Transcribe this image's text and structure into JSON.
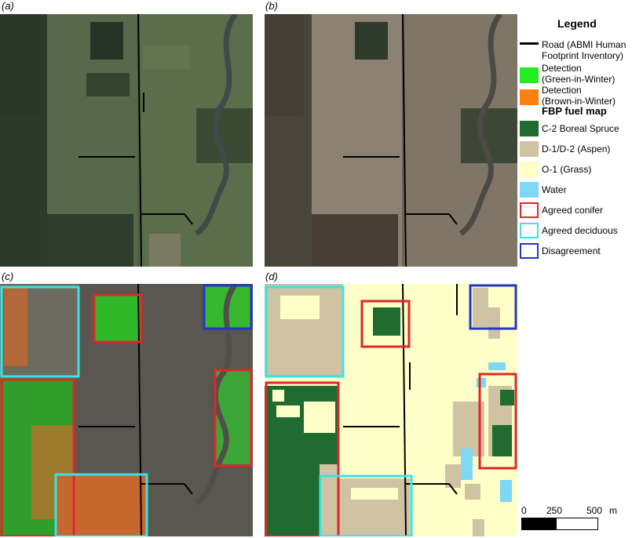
{
  "panels": {
    "a": "(a)",
    "b": "(b)",
    "c": "(c)",
    "d": "(d)"
  },
  "legend": {
    "title": "Legend",
    "items": [
      {
        "label": "Road (ABMI Human Footprint Inventory)",
        "line1": "Road (ABMI Human",
        "line2": "Footprint Inventory)",
        "color": "#000000",
        "kind": "line"
      },
      {
        "label": "Detection (Green-in-Winter)",
        "line1": "Detection",
        "line2": "(Green-in-Winter)",
        "color": "#22ee22",
        "kind": "fill"
      },
      {
        "label": "Detection (Brown-in-Winter)",
        "line1": "Detection",
        "line2": "(Brown-in-Winter)",
        "color": "#ff7f0e",
        "kind": "fill"
      }
    ],
    "fbp_title": "FBP fuel map",
    "fbp_items": [
      {
        "label": "C-2 Boreal Spruce",
        "color": "#1f6b30",
        "kind": "fill"
      },
      {
        "label": "D-1/D-2 (Aspen)",
        "color": "#cfc3a4",
        "kind": "fill"
      },
      {
        "label": "O-1 (Grass)",
        "color": "#ffffc8",
        "kind": "fill"
      },
      {
        "label": "Water",
        "color": "#7fd6f5",
        "kind": "fill"
      },
      {
        "label": "Agreed conifer",
        "color": "#e0262a",
        "kind": "outline"
      },
      {
        "label": "Agreed deciduous",
        "color": "#38e3e3",
        "kind": "outline"
      },
      {
        "label": "Disagreement",
        "color": "#2236c8",
        "kind": "outline"
      }
    ]
  },
  "scalebar": {
    "ticks": [
      "0",
      "250",
      "500"
    ],
    "unit": "m"
  }
}
